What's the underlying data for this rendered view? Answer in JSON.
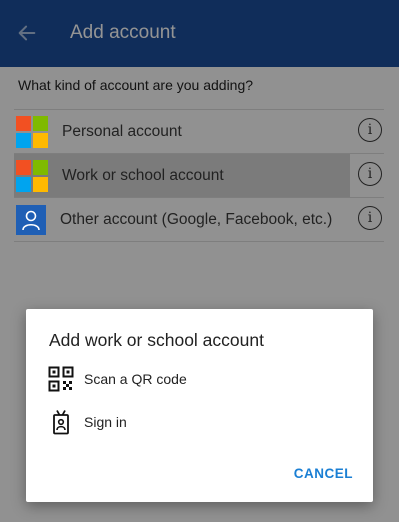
{
  "appbar": {
    "back_icon": "arrow-left-icon",
    "title": "Add account"
  },
  "page": {
    "question": "What kind of account are you adding?"
  },
  "accounts": [
    {
      "label": "Personal account",
      "icon": "microsoft-logo-icon",
      "info_icon": "info-icon",
      "selected": false
    },
    {
      "label": "Work or school account",
      "icon": "microsoft-logo-icon",
      "info_icon": "info-icon",
      "selected": true
    },
    {
      "label": "Other account (Google, Facebook, etc.)",
      "icon": "person-icon",
      "info_icon": "info-icon",
      "selected": false
    }
  ],
  "dialog": {
    "title": "Add work or school account",
    "options": [
      {
        "label": "Scan a QR code",
        "icon": "qr-code-icon"
      },
      {
        "label": "Sign in",
        "icon": "badge-icon"
      }
    ],
    "cancel_label": "CANCEL"
  },
  "colors": {
    "appbar": "#1c4f9c",
    "accent": "#1a7fd4",
    "selected_row": "#d4d4d4",
    "ms_red": "#f25022",
    "ms_green": "#7fba00",
    "ms_blue": "#00a4ef",
    "ms_yellow": "#ffb900"
  }
}
